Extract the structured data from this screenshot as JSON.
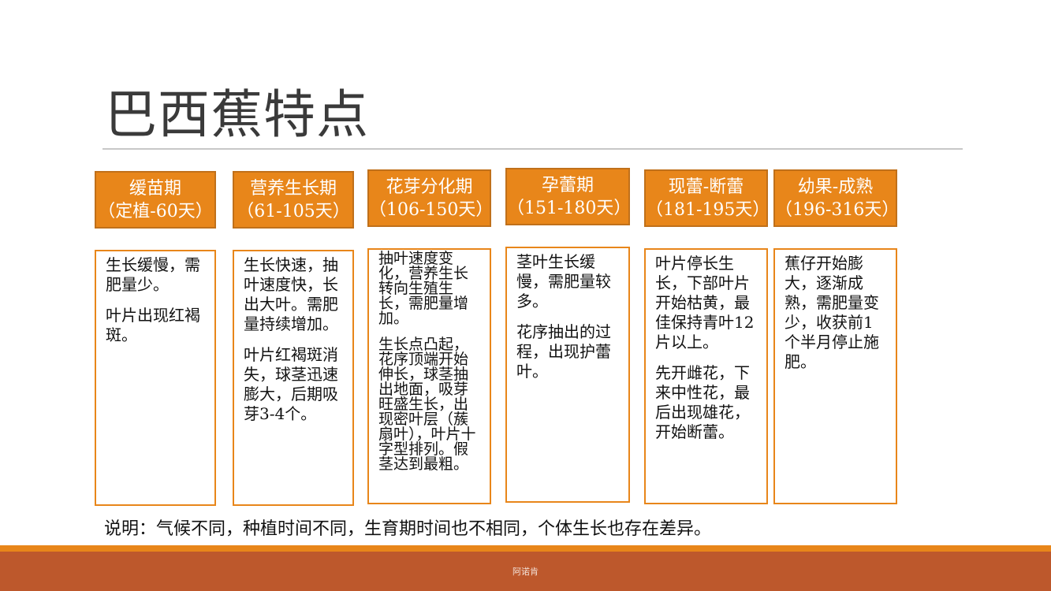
{
  "title": "巴西蕉特点",
  "stages": [
    {
      "name": "缓苗期",
      "range": "（定植-60天）",
      "details": [
        "生长缓慢，需肥量少。",
        "叶片出现红褐斑。"
      ]
    },
    {
      "name": "营养生长期",
      "range": "（61-105天）",
      "details": [
        "生长快速，抽叶速度快，长出大叶。需肥量持续增加。",
        "叶片红褐斑消失，球茎迅速膨大，后期吸芽3-4个。"
      ]
    },
    {
      "name": "花芽分化期",
      "range": "（106-150天）",
      "details": [
        "抽叶速度变化，营养生长转向生殖生长，需肥量增加。",
        "生长点凸起，花序顶端开始伸长，球茎抽出地面，吸芽旺盛生长，出现密叶层（蔟扇叶），叶片十字型排列。假茎达到最粗。"
      ]
    },
    {
      "name": "孕蕾期",
      "range": "（151-180天）",
      "details": [
        "茎叶生长缓慢，需肥量较多。",
        "花序抽出的过程，出现护蕾叶。"
      ]
    },
    {
      "name": "现蕾-断蕾",
      "range": "（181-195天）",
      "details": [
        "叶片停长生长，下部叶片开始枯黄，最佳保持青叶12片以上。",
        "先开雌花，下来中性花，最后出现雄花，开始断蕾。"
      ]
    },
    {
      "name": "幼果-成熟",
      "range": "（196-316天）",
      "details": [
        "蕉仔开始膨大，逐渐成熟，需肥量变少，收获前1个半月停止施肥。"
      ]
    }
  ],
  "note": "说明：气候不同，种植时间不同，生育期时间也不相同，个体生长也存在差异。",
  "footer": "阿诺肯",
  "colors": {
    "accent": "#e8861a",
    "footer": "#bd582c",
    "title": "#3a3a3a"
  }
}
